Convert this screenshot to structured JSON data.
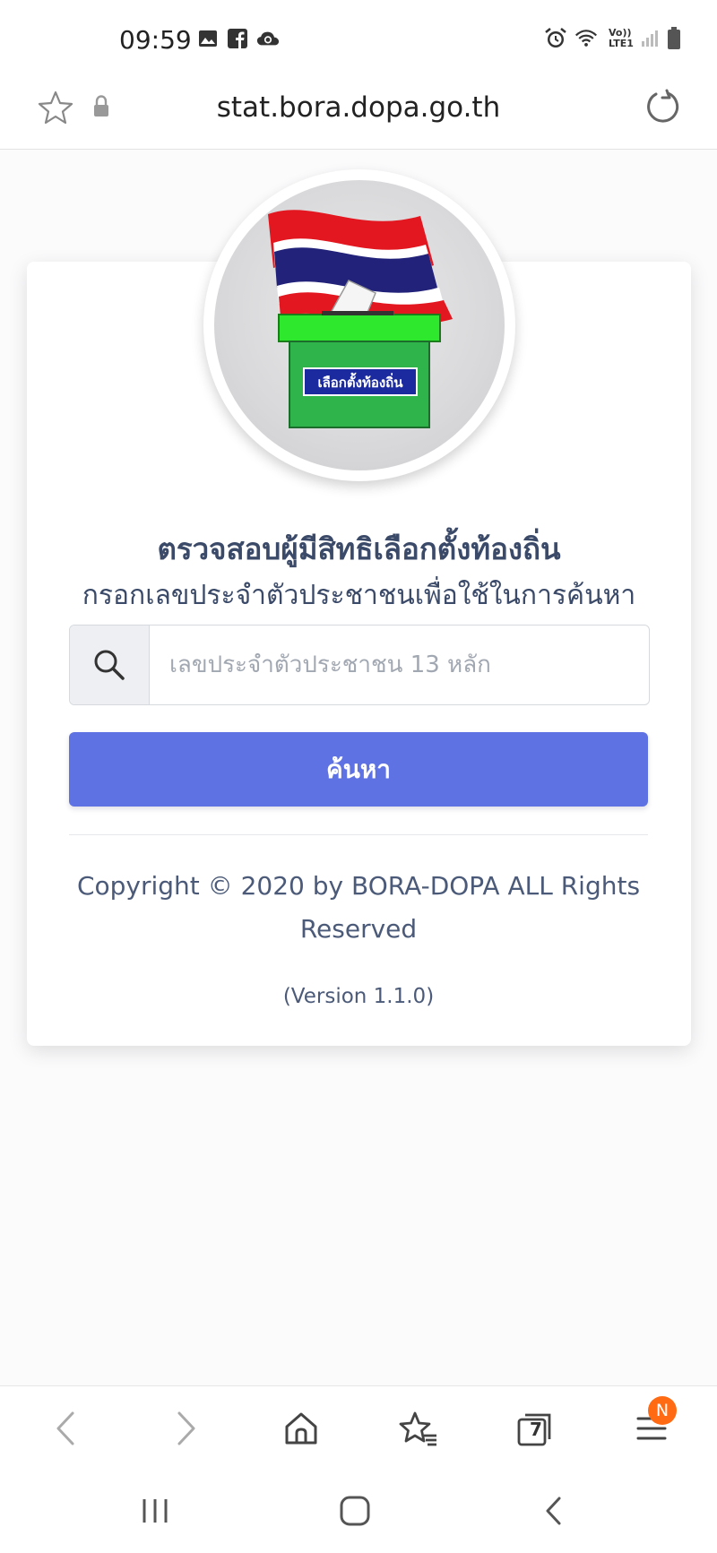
{
  "status_bar": {
    "time": "09:59",
    "left_icons": [
      "image-icon",
      "facebook-icon",
      "cloud-sync-icon"
    ],
    "right_icons": [
      "alarm-icon",
      "wifi-icon",
      "volte-icon",
      "signal-icon",
      "battery-icon"
    ],
    "volte_label": "Vo))",
    "lte_label": "LTE1"
  },
  "browser": {
    "url": "stat.bora.dopa.go.th",
    "icons": [
      "bookmark-star-icon",
      "lock-icon",
      "reload-icon"
    ]
  },
  "logo": {
    "box_label": "เลือกตั้งท้องถิ่น"
  },
  "main": {
    "title": "ตรวจสอบผู้มีสิทธิเลือกตั้งท้องถิ่น",
    "subtitle": "กรอกเลขประจำตัวประชาชนเพื่อใช้ในการค้นหา",
    "search_input": {
      "placeholder": "เลขประจำตัวประชาชน 13 หลัก",
      "value": ""
    },
    "search_button_label": "ค้นหา",
    "copyright_line1": "Copyright © 2020 by BORA-DOPA ALL Rights",
    "copyright_line2": "Reserved",
    "version": "(Version 1.1.0)"
  },
  "bottom_bar": {
    "icons": [
      "back-icon",
      "forward-icon",
      "home-icon",
      "bookmarks-icon",
      "tabs-icon",
      "menu-icon"
    ],
    "tab_count": "7",
    "menu_badge": "N"
  },
  "system_nav": {
    "icons": [
      "recents-icon",
      "home-button-icon",
      "system-back-icon"
    ]
  },
  "colors": {
    "primary": "#5f72e4",
    "text": "#3b4a68",
    "badge": "#ff6a13"
  }
}
